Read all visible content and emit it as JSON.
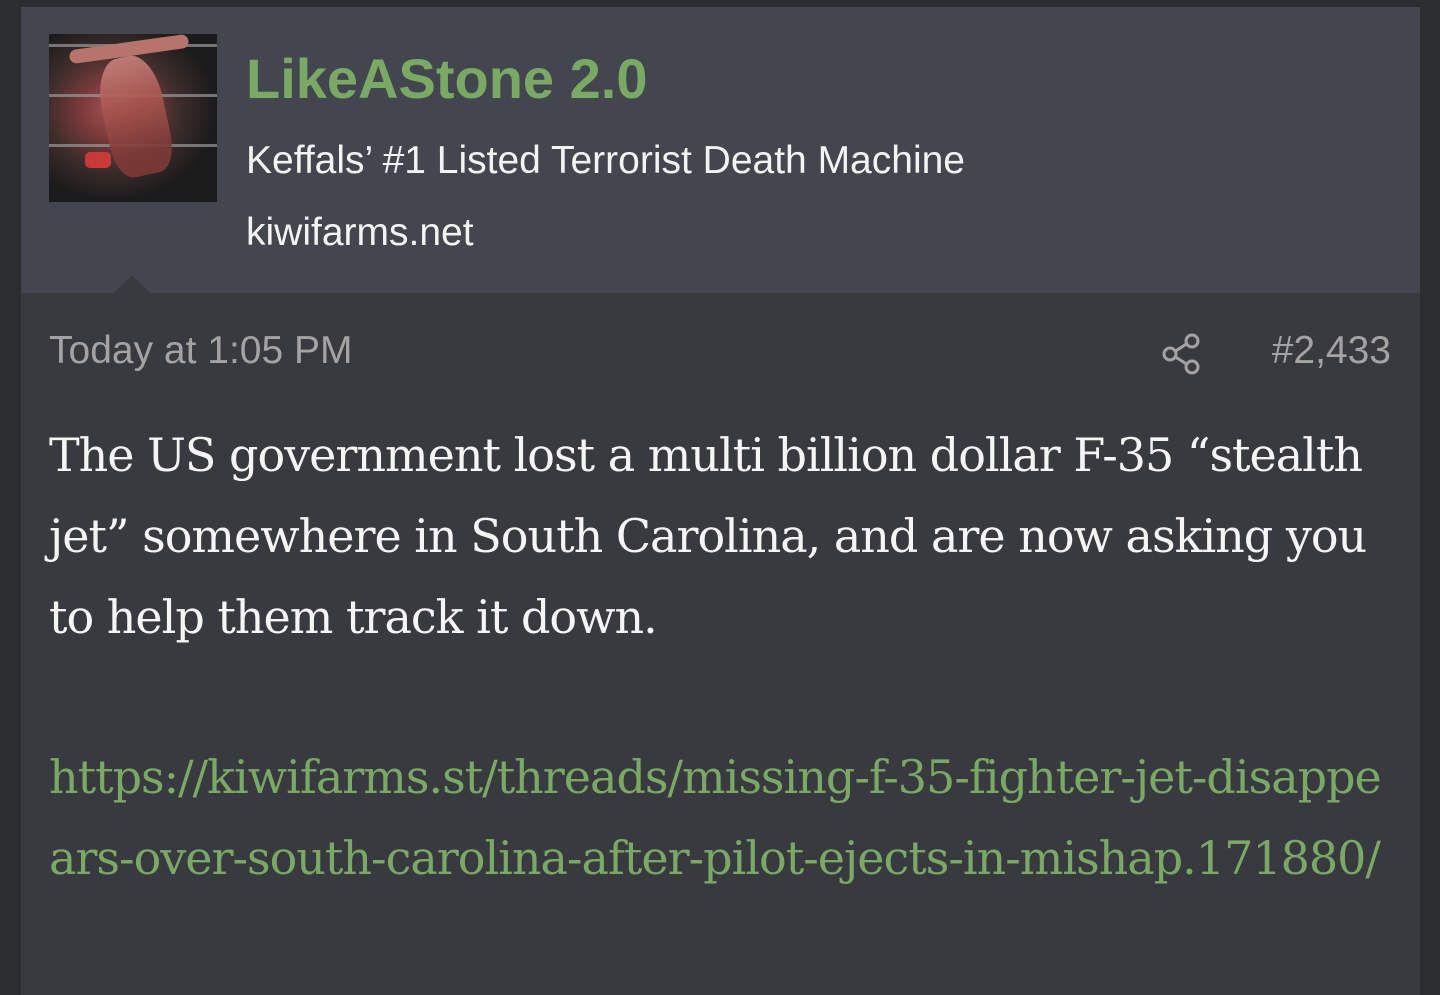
{
  "user": {
    "name": "LikeAStone 2.0",
    "title": "Keffals’ #1 Listed Terrorist Death Machine",
    "site": "kiwifarms.net",
    "avatar_icon": "wrestler-avatar"
  },
  "post": {
    "date": "Today at 1:05 PM",
    "number": "#2,433",
    "share_icon": "share-icon",
    "body": "The US government lost a multi billion dollar F-35 “stealth jet” somewhere in South Carolina, and are now asking you to help them track it down.",
    "link": "https://kiwifarms.st/threads/missing-f-35-fighter-jet-disappears-over-south-carolina-after-pilot-ejects-in-mishap.171880/"
  },
  "colors": {
    "accent_green": "#79a965",
    "header_bg": "#43464e",
    "post_bg": "#383a40",
    "page_bg": "#2b2d31"
  }
}
